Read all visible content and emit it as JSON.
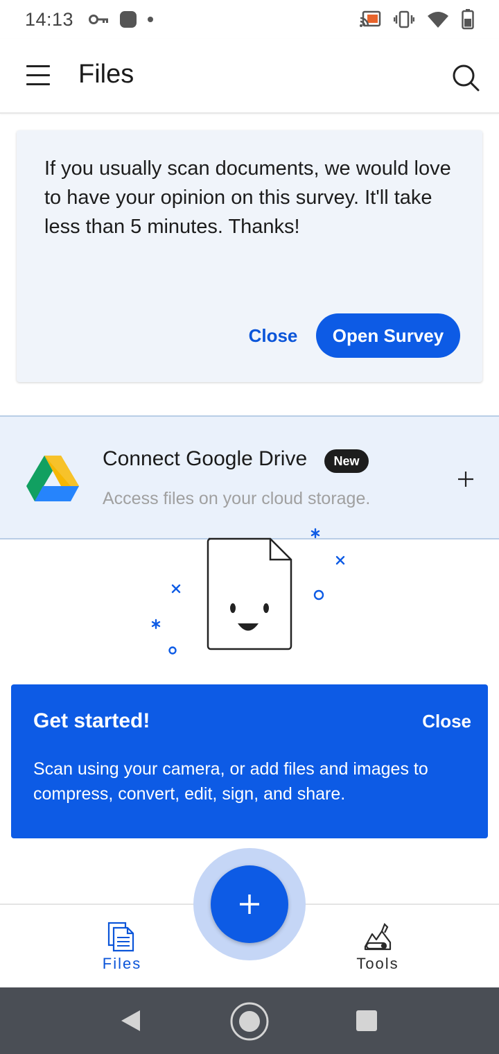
{
  "status_bar": {
    "time": "14:13",
    "left_icons": [
      "key-icon",
      "notification-dot-icon",
      "small-dot-icon"
    ],
    "right_icons": [
      "cast-icon",
      "vibrate-icon",
      "wifi-icon",
      "battery-icon"
    ]
  },
  "app_bar": {
    "title": "Files",
    "menu_icon": "hamburger-menu-icon",
    "search_icon": "search-icon"
  },
  "survey": {
    "text": "If you usually scan documents, we would love to have your opinion on this survey. It'll take less than 5 minutes. Thanks!",
    "close_label": "Close",
    "open_label": "Open Survey"
  },
  "drive": {
    "title": "Connect Google Drive",
    "badge": "New",
    "subtitle": "Access files on your cloud storage.",
    "logo_icon": "google-drive-icon",
    "action_icon": "plus-icon"
  },
  "get_started": {
    "title": "Get started!",
    "close_label": "Close",
    "text": "Scan using your camera, or add files and images to compress, convert, edit, sign, and share."
  },
  "fab": {
    "icon": "plus-icon"
  },
  "bottom_nav": {
    "items": [
      {
        "label": "Files",
        "icon": "files-icon",
        "active": true
      },
      {
        "label": "Tools",
        "icon": "tools-icon",
        "active": false
      }
    ]
  },
  "system_nav": [
    "back-icon",
    "home-icon",
    "recents-icon"
  ],
  "colors": {
    "accent": "#0d5be5",
    "survey_bg": "#f0f4fa",
    "drive_bg": "#eaf1fb",
    "system_nav_bg": "#4a4e55"
  }
}
